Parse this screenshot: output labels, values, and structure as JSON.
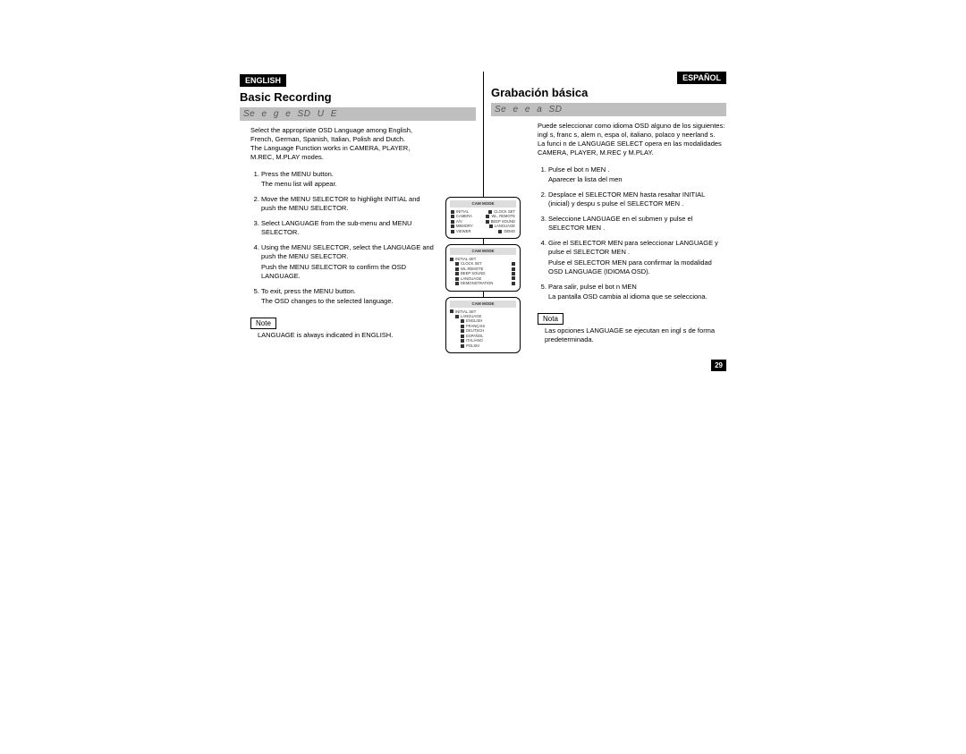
{
  "pagenum": "29",
  "left": {
    "lang": "ENGLISH",
    "title": "Basic Recording",
    "subtitle": "Se e    g   e  SD     U  E",
    "intro": "Select the appropriate OSD Language among English, French, German, Spanish, Italian, Polish and Dutch.\nThe Language Function works in CAMERA, PLAYER, M.REC, M.PLAY modes.",
    "steps": [
      {
        "t": "Press the MENU button.",
        "s": "The menu list will appear."
      },
      {
        "t": "Move the MENU SELECTOR to highlight INITIAL and push the MENU SELECTOR."
      },
      {
        "t": "Select LANGUAGE from the sub-menu and MENU SELECTOR."
      },
      {
        "t": "Using the MENU SELECTOR, select the LANGUAGE and push the MENU SELECTOR.",
        "s": "Push the MENU SELECTOR to confirm the OSD LANGUAGE."
      },
      {
        "t": "To exit, press the MENU button.",
        "s": "The OSD changes to the selected language."
      }
    ],
    "note_label": "Note",
    "note": "LANGUAGE  is always indicated in ENGLISH."
  },
  "right": {
    "lang": "ESPAÑOL",
    "title": "Grabación básica",
    "subtitle": "Se e       e       a  SD",
    "intro": "Puede seleccionar como idioma OSD alguno de los siguientes: ingl s, franc s, alem n, espa ol, italiano, polaco y neerland s.\nLa funci n de LANGUAGE SELECT opera en las modalidades CAMERA, PLAYER, M.REC y M.PLAY.",
    "steps": [
      {
        "t": "Pulse el bot n MEN .",
        "s": "Aparecer  la lista del men"
      },
      {
        "t": "Desplace el SELECTOR MEN  hasta resaltar INITIAL (inicial) y despu s pulse el SELECTOR MEN ."
      },
      {
        "t": "Seleccione LANGUAGE en el submen  y pulse el SELECTOR MEN ."
      },
      {
        "t": "Gire el SELECTOR MEN  para seleccionar LANGUAGE y pulse el SELECTOR MEN .",
        "s": "Pulse el SELECTOR MEN  para confirmar la modalidad OSD LANGUAGE (IDIOMA OSD)."
      },
      {
        "t": "Para salir, pulse el bot n MEN",
        "s": "La pantalla OSD cambia al idioma que se selecciona."
      }
    ],
    "note_label": "Nota",
    "note": "Las opciones  LANGUAGE  se ejecutan en ingl s de forma predeterminada."
  },
  "figures": {
    "f1": {
      "hdr": "CAM MODE",
      "left": [
        "INITIAL",
        "CAMERA",
        "A/V",
        "MEMORY",
        "VIEWER"
      ],
      "right": [
        "CLOCK SET",
        "WL. REMOTE",
        "BEEP SOUND",
        "LANGUAGE",
        "DEMO"
      ]
    },
    "f2": {
      "hdr": "CAM MODE",
      "top": "INITIAL SET",
      "items": [
        "CLOCK SET",
        "WL.REMOTE",
        "BEEP SOUND",
        "LANGUAGE",
        "DEMONSTRATION"
      ]
    },
    "f3": {
      "hdr": "CAM MODE",
      "top": "INITIAL SET",
      "sub": "LANGUAGE",
      "items": [
        "ENGLISH",
        "FRANÇAIS",
        "DEUTSCH",
        "ESPAÑOL",
        "ITALIANO",
        "POLSKI"
      ]
    }
  }
}
